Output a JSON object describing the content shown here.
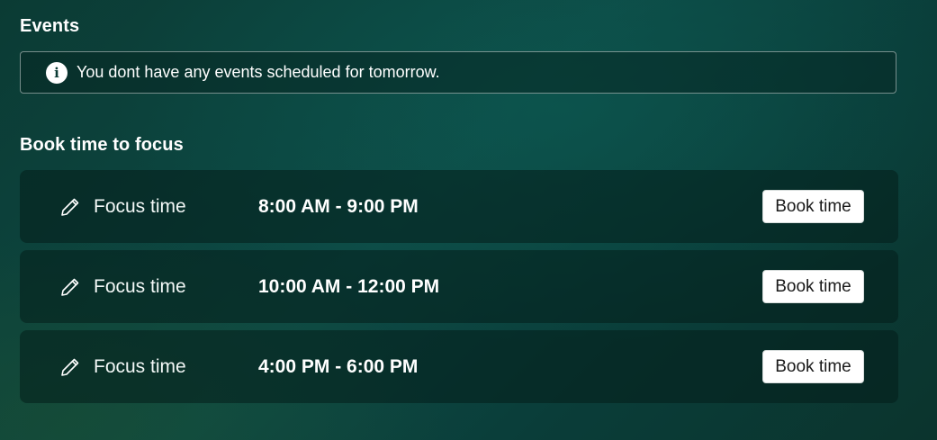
{
  "events": {
    "title": "Events",
    "info_icon": "info-icon",
    "message": "You dont have any events scheduled for tomorrow."
  },
  "focus": {
    "title": "Book time to focus",
    "slots": [
      {
        "label": "Focus time",
        "range": "8:00 AM - 9:00 PM",
        "button": "Book time",
        "icon": "pencil-icon"
      },
      {
        "label": "Focus time",
        "range": "10:00 AM - 12:00 PM",
        "button": "Book time",
        "icon": "pencil-icon"
      },
      {
        "label": "Focus time",
        "range": "4:00 PM - 6:00 PM",
        "button": "Book time",
        "icon": "pencil-icon"
      }
    ]
  }
}
